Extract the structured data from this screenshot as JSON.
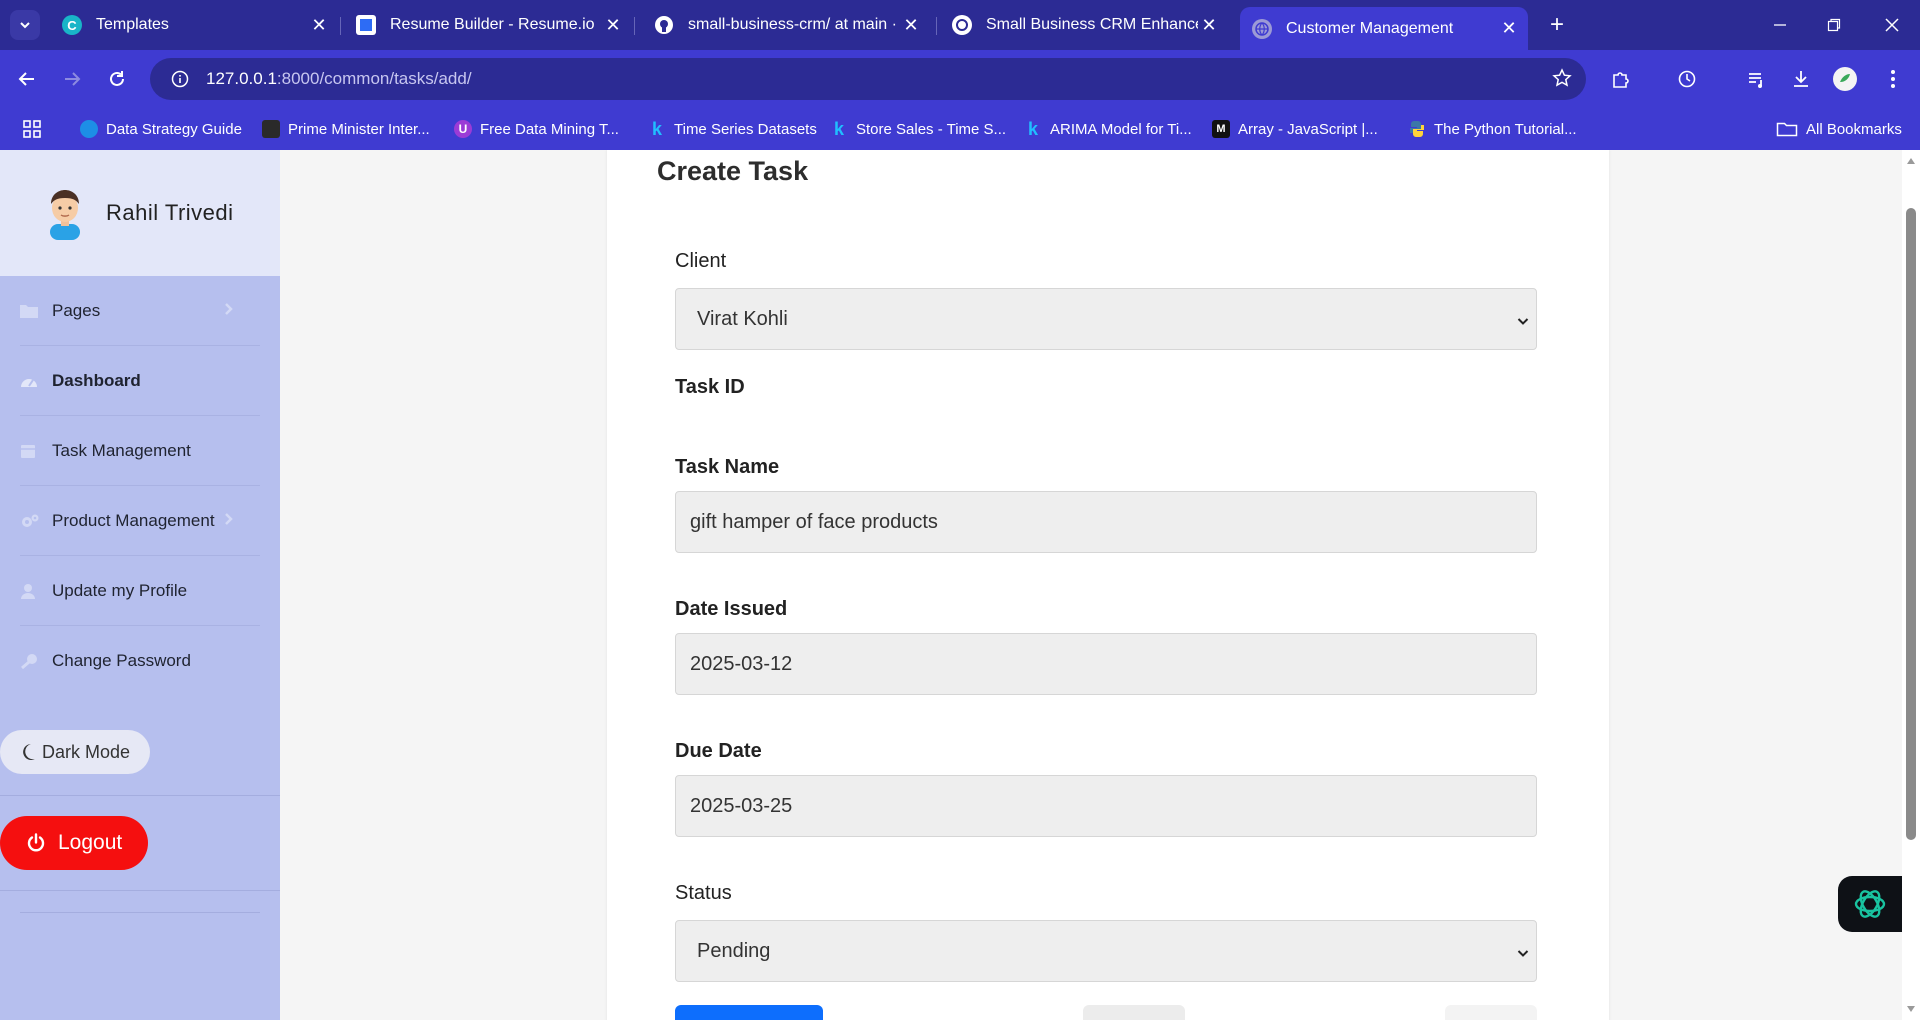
{
  "browser": {
    "tabs": [
      {
        "title": "Templates",
        "favicon": "canva-icon",
        "active": false
      },
      {
        "title": "Resume Builder - Resume.io",
        "favicon": "resumeio-icon",
        "active": false
      },
      {
        "title": "small-business-crm/ at main · ra",
        "favicon": "github-icon",
        "active": false
      },
      {
        "title": "Small Business CRM Enhanceme",
        "favicon": "openai-icon",
        "active": false
      },
      {
        "title": "Customer Management",
        "favicon": "globe-icon",
        "active": true
      }
    ],
    "url_host": "127.0.0.1",
    "url_path": ":8000/common/tasks/add/",
    "bookmarks": [
      "Data Strategy Guide",
      "Prime Minister Inter...",
      "Free Data Mining T...",
      "Time Series Datasets",
      "Store Sales - Time S...",
      "ARIMA Model for Ti...",
      "Array - JavaScript |...",
      "The Python Tutorial..."
    ],
    "all_bookmarks": "All Bookmarks"
  },
  "sidebar": {
    "user_name": "Rahil Trivedi",
    "items": [
      {
        "label": "Pages",
        "icon": "folder-icon",
        "has_chevron": true
      },
      {
        "label": "Dashboard",
        "icon": "gauge-icon",
        "has_chevron": false
      },
      {
        "label": "Task Management",
        "icon": "calendar-icon",
        "has_chevron": false
      },
      {
        "label": "Product Management",
        "icon": "gears-icon",
        "has_chevron": true
      },
      {
        "label": "Update my Profile",
        "icon": "user-icon",
        "has_chevron": false
      },
      {
        "label": "Change Password",
        "icon": "key-icon",
        "has_chevron": false
      }
    ],
    "dark_mode_label": "Dark Mode",
    "logout_label": "Logout"
  },
  "form": {
    "title": "Create Task",
    "client_label": "Client",
    "client_value": "Virat Kohli",
    "task_id_label": "Task ID",
    "task_name_label": "Task Name",
    "task_name_value": "gift hamper of face products",
    "date_issued_label": "Date Issued",
    "date_issued_value": "2025-03-12",
    "due_date_label": "Due Date",
    "due_date_value": "2025-03-25",
    "status_label": "Status",
    "status_value": "Pending"
  },
  "colors": {
    "browser_frame": "#2c2b94",
    "browser_toolbar": "#3f3bd1",
    "sidebar_bg": "#b6bfee",
    "logout": "#f50f0f",
    "primary_button": "#0d6efd"
  }
}
